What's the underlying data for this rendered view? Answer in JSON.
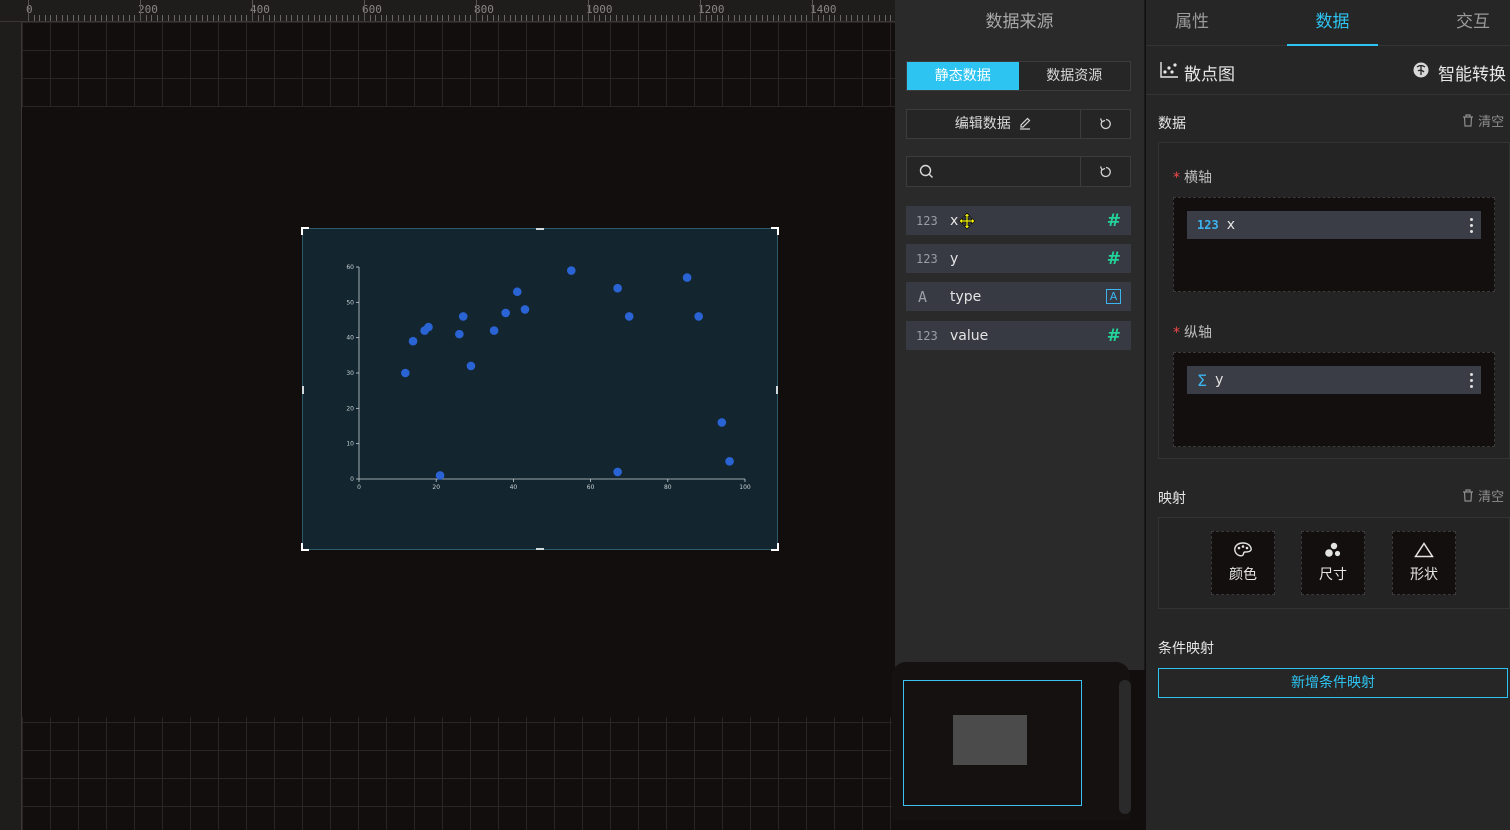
{
  "canvas": {
    "ruler_labels": [
      "0",
      "200",
      "400",
      "600",
      "800",
      "1000",
      "1200",
      "1400"
    ]
  },
  "chart_data": {
    "type": "scatter",
    "x": [
      12,
      14,
      17,
      18,
      21,
      26,
      27,
      29,
      35,
      38,
      41,
      43,
      55,
      67,
      67,
      70,
      85,
      88,
      94,
      96
    ],
    "y": [
      30,
      39,
      42,
      43,
      1,
      41,
      46,
      32,
      42,
      47,
      53,
      48,
      59,
      54,
      2,
      46,
      57,
      46,
      16,
      5
    ],
    "xlim": [
      0,
      100
    ],
    "ylim": [
      0,
      60
    ],
    "x_ticks": [
      "0",
      "20",
      "40",
      "60",
      "80",
      "100"
    ],
    "y_ticks": [
      "0",
      "10",
      "20",
      "30",
      "40",
      "50",
      "60"
    ],
    "point_color": "#2a63d4",
    "background": "#13262f",
    "grid": false
  },
  "data_source": {
    "title": "数据来源",
    "tabs": [
      {
        "label": "静态数据",
        "active": true
      },
      {
        "label": "数据资源",
        "active": false
      }
    ],
    "edit_label": "编辑数据",
    "search_placeholder": "",
    "fields": [
      {
        "type_label": "123",
        "name": "x",
        "icon": "hash-icon"
      },
      {
        "type_label": "123",
        "name": "y",
        "icon": "hash-icon"
      },
      {
        "type_label": "A",
        "name": "type",
        "icon": "string-icon"
      },
      {
        "type_label": "123",
        "name": "value",
        "icon": "hash-icon"
      }
    ]
  },
  "config": {
    "tabs": [
      {
        "label": "属性",
        "active": false
      },
      {
        "label": "数据",
        "active": true
      },
      {
        "label": "交互",
        "active": false
      }
    ],
    "chart_type": "散点图",
    "smart_convert": "智能转换",
    "data_section": "数据",
    "clear_label": "清空",
    "x_axis_label": "横轴",
    "y_axis_label": "纵轴",
    "x_axis_field": {
      "type_label": "123",
      "name": "x"
    },
    "y_axis_field": {
      "type_label": "Σ",
      "name": "y"
    },
    "mapping_section": "映射",
    "mapping_clear_label": "清空",
    "mapping_buttons": [
      "颜色",
      "尺寸",
      "形状"
    ],
    "condition_section": "条件映射",
    "add_condition_label": "新增条件映射"
  },
  "colors": {
    "accent": "#2ec4f1",
    "numeric_field": "#22d39a",
    "required": "#f24a4a"
  }
}
